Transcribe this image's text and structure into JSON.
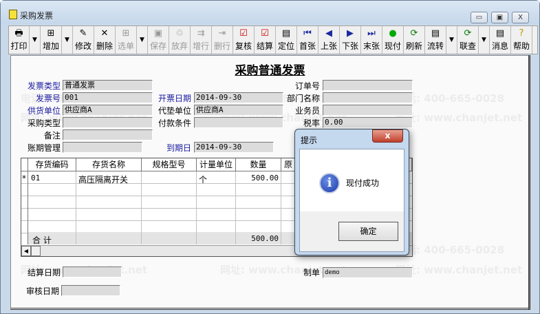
{
  "window": {
    "title": "采购发票",
    "minimize": "▭",
    "maximize": "▣",
    "close": "X"
  },
  "toolbar": [
    {
      "label": "打印",
      "icon": "printer",
      "enabled": true
    },
    {
      "label": "",
      "icon": "dropdown",
      "enabled": true
    },
    {
      "label": "增加",
      "icon": "add",
      "enabled": true
    },
    {
      "label": "",
      "icon": "dropdown",
      "enabled": true
    },
    {
      "label": "修改",
      "icon": "edit",
      "enabled": true
    },
    {
      "label": "删除",
      "icon": "delete",
      "enabled": true
    },
    {
      "label": "选单",
      "icon": "select",
      "enabled": false
    },
    {
      "label": "",
      "icon": "dropdown",
      "enabled": true
    },
    {
      "label": "保存",
      "icon": "save",
      "enabled": false
    },
    {
      "label": "放弃",
      "icon": "discard",
      "enabled": false
    },
    {
      "label": "增行",
      "icon": "add-row",
      "enabled": false
    },
    {
      "label": "删行",
      "icon": "delete-row",
      "enabled": false
    },
    {
      "label": "复核",
      "icon": "review",
      "enabled": true
    },
    {
      "label": "结算",
      "icon": "settle",
      "enabled": true
    },
    {
      "label": "定位",
      "icon": "locate",
      "enabled": true
    },
    {
      "label": "首张",
      "icon": "first",
      "enabled": true
    },
    {
      "label": "上张",
      "icon": "prev",
      "enabled": true
    },
    {
      "label": "下张",
      "icon": "next",
      "enabled": true
    },
    {
      "label": "末张",
      "icon": "last",
      "enabled": true
    },
    {
      "label": "现付",
      "icon": "pay",
      "enabled": true
    },
    {
      "label": "刷新",
      "icon": "refresh",
      "enabled": true
    },
    {
      "label": "流转",
      "icon": "flow",
      "enabled": true
    },
    {
      "label": "",
      "icon": "dropdown",
      "enabled": true
    },
    {
      "label": "联查",
      "icon": "query",
      "enabled": true
    },
    {
      "label": "",
      "icon": "dropdown",
      "enabled": true
    },
    {
      "label": "消息",
      "icon": "message",
      "enabled": true
    },
    {
      "label": "帮助",
      "icon": "help",
      "enabled": true
    }
  ],
  "doc_title": "采购普通发票",
  "header": {
    "invoice_type": {
      "label": "发票类型",
      "value": "普通发票"
    },
    "invoice_no": {
      "label": "发票号",
      "value": "001"
    },
    "supplier": {
      "label": "供货单位",
      "value": "供应商A"
    },
    "purchase_type": {
      "label": "采购类型",
      "value": ""
    },
    "remark": {
      "label": "备注",
      "value": ""
    },
    "account_period": {
      "label": "账期管理",
      "value": ""
    },
    "invoice_date": {
      "label": "开票日期",
      "value": "2014-09-30"
    },
    "advance_unit": {
      "label": "代垫单位",
      "value": "供应商A"
    },
    "payment_terms": {
      "label": "付款条件",
      "value": ""
    },
    "due_date": {
      "label": "到期日",
      "value": "2014-09-30"
    },
    "order_no": {
      "label": "订单号",
      "value": ""
    },
    "department": {
      "label": "部门名称",
      "value": ""
    },
    "salesperson": {
      "label": "业务员",
      "value": ""
    },
    "tax_rate": {
      "label": "税率",
      "value": "0.00"
    }
  },
  "grid": {
    "columns": [
      "存货编码",
      "存货名称",
      "规格型号",
      "计量单位",
      "数量",
      "原"
    ],
    "rows": [
      {
        "marker": "*",
        "code": "01",
        "name": "高压隔离开关",
        "spec": "",
        "unit": "个",
        "qty": "500.00"
      }
    ],
    "total_label": "合  计",
    "total_qty": "500.00"
  },
  "footer": {
    "settle_date": {
      "label": "结算日期",
      "value": ""
    },
    "review_date": {
      "label": "审核日期",
      "value": ""
    },
    "maker": {
      "label": "制单",
      "value": "demo"
    }
  },
  "dialog": {
    "title": "提示",
    "message": "现付成功",
    "ok": "确定",
    "close": "x"
  },
  "watermark": {
    "phone": "电话: 400-665-0028",
    "site": "网址: www.chanjet.net"
  }
}
